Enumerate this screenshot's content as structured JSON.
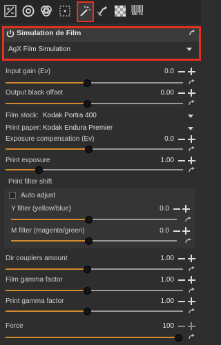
{
  "toolbar": {
    "icons": [
      "white-balance-icon",
      "aperture-icon",
      "color-rings-icon",
      "dotted-square-icon",
      "magic-wand-icon",
      "retouch-brush-icon",
      "checkerboard-icon",
      "meta-icon"
    ],
    "meta_label": "META",
    "selected": "magic-wand-icon"
  },
  "module": {
    "title": "Simulation de Film",
    "preset": "AgX Film Simulation"
  },
  "params": {
    "input_gain": {
      "label": "Input gain (Ev)",
      "value": "0.0",
      "fraction": 0.46
    },
    "output_black": {
      "label": "Output black offset",
      "value": "0.00",
      "fraction": 0.46
    },
    "film_stock": {
      "label": "Film stock:",
      "value": "Kodak Portra 400"
    },
    "print_paper": {
      "label": "Print paper:",
      "value": "Kodak Endura Premier"
    },
    "exposure_comp": {
      "label": "Exposure compensation (Ev)",
      "value": "0.0",
      "fraction": 0.47
    },
    "print_exposure": {
      "label": "Print exposure",
      "value": "1.00",
      "fraction": 0.19
    },
    "print_filter_shift": {
      "label": "Print filter shift",
      "auto_adjust": {
        "label": "Auto adjust",
        "checked": false
      },
      "y_filter": {
        "label": "Y filter (yellow/blue)",
        "value": "0.0",
        "fraction": 0.47
      },
      "m_filter": {
        "label": "M filter (magenta/green)",
        "value": "0.0",
        "fraction": 0.47
      }
    },
    "dir_couplers": {
      "label": "Dir couplers amount",
      "value": "1.00",
      "fraction": 0.46
    },
    "film_gamma": {
      "label": "Film gamma factor",
      "value": "1.00",
      "fraction": 0.46
    },
    "print_gamma": {
      "label": "Print gamma factor",
      "value": "1.00",
      "fraction": 0.46
    },
    "force": {
      "label": "Force",
      "value": "100",
      "fraction": 1.0
    }
  },
  "colors": {
    "highlight": "#e8301e",
    "slider_fill": "#d48a2c",
    "background": "#2e2e2e"
  }
}
